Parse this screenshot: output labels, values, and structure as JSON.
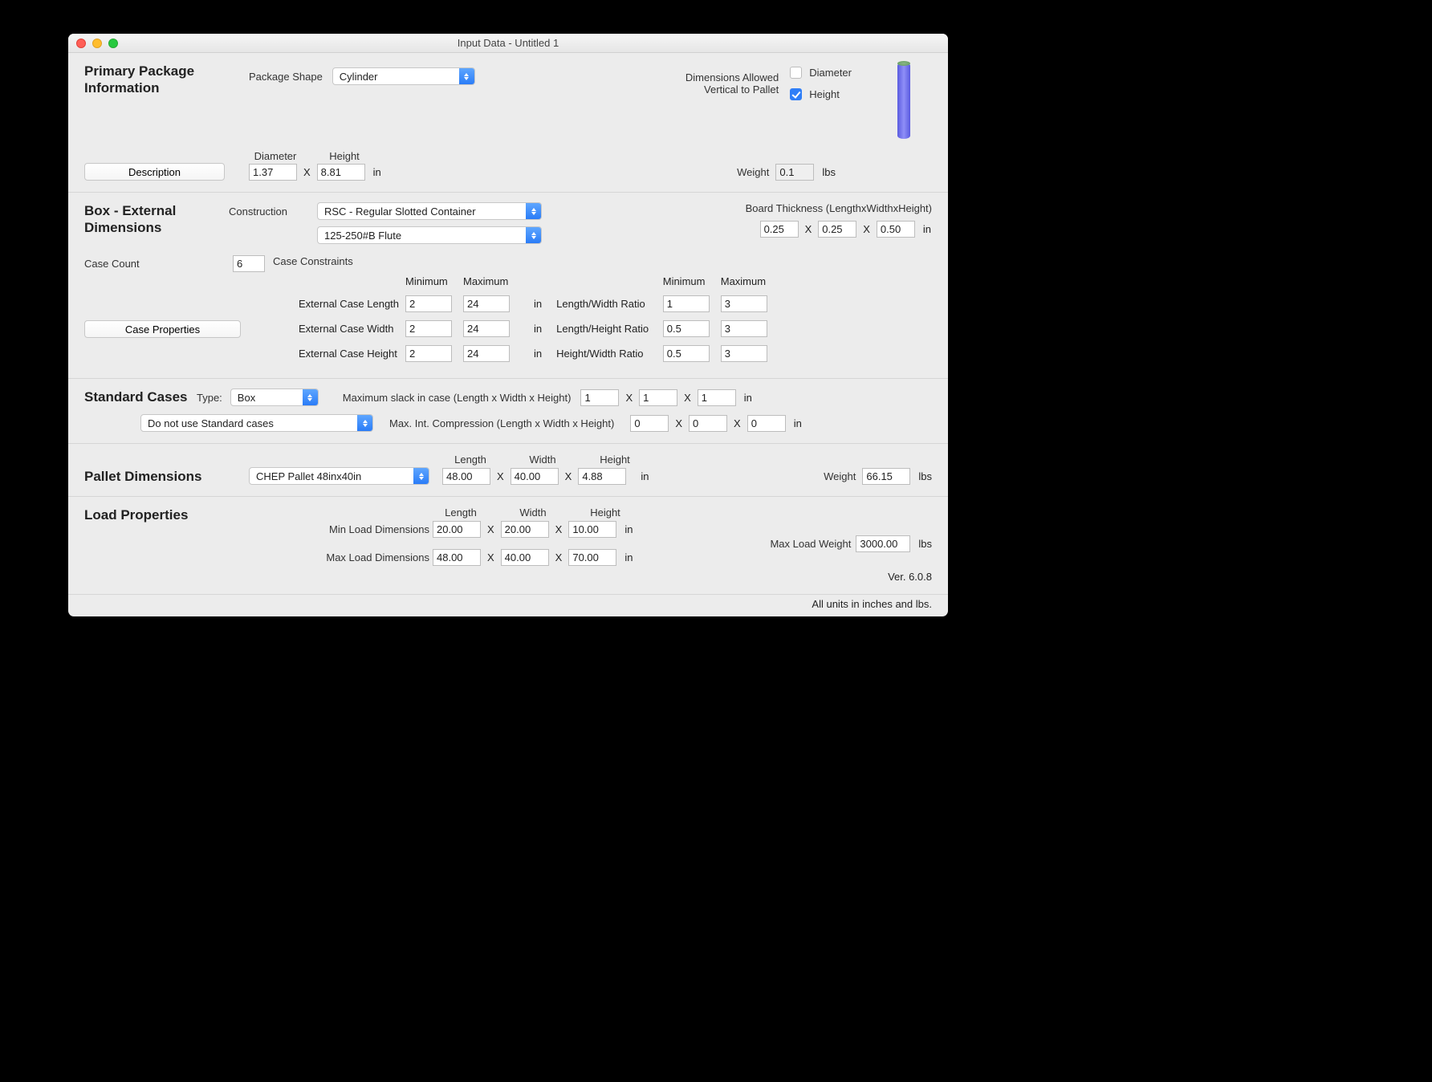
{
  "window_title": "Input Data - Untitled 1",
  "primary": {
    "heading": "Primary Package\nInformation",
    "package_shape_label": "Package Shape",
    "package_shape_value": "Cylinder",
    "dimensions_allowed_label": "Dimensions Allowed\nVertical to Pallet",
    "diameter_checkbox_label": "Diameter",
    "diameter_checked": false,
    "height_checkbox_label": "Height",
    "height_checked": true,
    "description_button": "Description",
    "diameter_label": "Diameter",
    "height_label": "Height",
    "diameter_value": "1.37",
    "height_value": "8.81",
    "dim_unit": "in",
    "weight_label": "Weight",
    "weight_value": "0.1",
    "weight_unit": "lbs"
  },
  "box": {
    "heading": "Box - External\nDimensions",
    "construction_label": "Construction",
    "construction_value": "RSC - Regular Slotted Container",
    "flute_value": "125-250#B Flute",
    "board_thickness_label": "Board Thickness (LengthxWidthxHeight)",
    "bt_l": "0.25",
    "bt_w": "0.25",
    "bt_h": "0.50",
    "bt_unit": "in",
    "case_count_label": "Case Count",
    "case_count_value": "6",
    "case_constraints_label": "Case Constraints",
    "min_label": "Minimum",
    "max_label": "Maximum",
    "ext_len_label": "External Case Length",
    "ext_wid_label": "External Case Width",
    "ext_hgt_label": "External Case Height",
    "ecl_min": "2",
    "ecl_max": "24",
    "ecw_min": "2",
    "ecw_max": "24",
    "ech_min": "2",
    "ech_max": "24",
    "cc_unit": "in",
    "lw_ratio_label": "Length/Width Ratio",
    "lh_ratio_label": "Length/Height Ratio",
    "hw_ratio_label": "Height/Width Ratio",
    "lw_min": "1",
    "lw_max": "3",
    "lh_min": "0.5",
    "lh_max": "3",
    "hw_min": "0.5",
    "hw_max": "3",
    "case_properties_button": "Case Properties"
  },
  "standard": {
    "heading": "Standard Cases",
    "type_label": "Type:",
    "type_value": "Box",
    "mode_value": "Do not use Standard cases",
    "slack_label": "Maximum slack in case  (Length x Width x Height)",
    "slack_l": "1",
    "slack_w": "1",
    "slack_h": "1",
    "slack_unit": "in",
    "compress_label": "Max. Int. Compression (Length x Width x Height)",
    "comp_l": "0",
    "comp_w": "0",
    "comp_h": "0",
    "comp_unit": "in"
  },
  "pallet": {
    "heading": "Pallet Dimensions",
    "pallet_value": "CHEP Pallet 48inx40in",
    "length_label": "Length",
    "width_label": "Width",
    "height_label": "Height",
    "length": "48.00",
    "width": "40.00",
    "height": "4.88",
    "dim_unit": "in",
    "weight_label": "Weight",
    "weight": "66.15",
    "weight_unit": "lbs"
  },
  "load": {
    "heading": "Load Properties",
    "length_label": "Length",
    "width_label": "Width",
    "height_label": "Height",
    "min_label": "Min Load Dimensions",
    "max_label": "Max Load Dimensions",
    "min_l": "20.00",
    "min_w": "20.00",
    "min_h": "10.00",
    "max_l": "48.00",
    "max_w": "40.00",
    "max_h": "70.00",
    "dim_unit": "in",
    "max_weight_label": "Max Load Weight",
    "max_weight": "3000.00",
    "weight_unit": "lbs"
  },
  "footer": {
    "version": "Ver. 6.0.8",
    "units_note": "All units in inches and lbs."
  }
}
